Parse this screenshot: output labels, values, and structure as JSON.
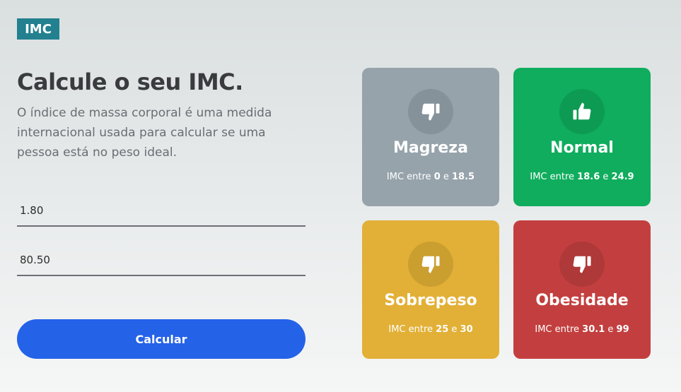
{
  "logo": {
    "text": "IMC"
  },
  "hero": {
    "title": "Calcule o seu IMC.",
    "description": "O índice de massa corporal é uma medida internacional usada para calcular se uma pessoa está no peso ideal."
  },
  "form": {
    "height_value": "1.80",
    "weight_value": "80.50",
    "submit_label": "Calcular"
  },
  "cards": [
    {
      "title": "Magreza",
      "prefix": "IMC entre",
      "min": "0",
      "sep": "e",
      "max": "18.5",
      "icon": "thumbs-down-icon",
      "color": "#96a3ab"
    },
    {
      "title": "Normal",
      "prefix": "IMC entre",
      "min": "18.6",
      "sep": "e",
      "max": "24.9",
      "icon": "thumbs-up-icon",
      "color": "#0fad5d"
    },
    {
      "title": "Sobrepeso",
      "prefix": "IMC entre",
      "min": "25",
      "sep": "e",
      "max": "30",
      "icon": "thumbs-down-icon",
      "color": "#e2b036"
    },
    {
      "title": "Obesidade",
      "prefix": "IMC entre",
      "min": "30.1",
      "sep": "e",
      "max": "99",
      "icon": "thumbs-down-icon",
      "color": "#c33f3f"
    }
  ],
  "colors": {
    "accent": "#2462e8",
    "logo_bg": "#22808f"
  }
}
